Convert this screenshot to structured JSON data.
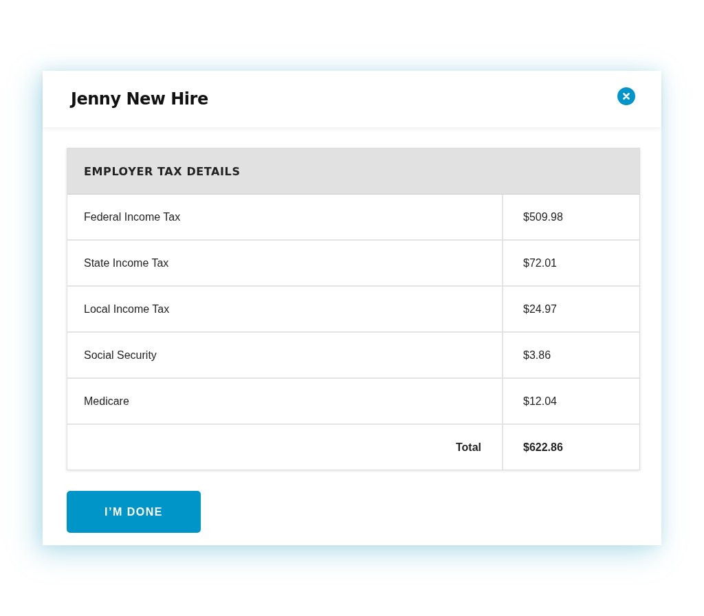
{
  "dialog": {
    "title": "Jenny New Hire"
  },
  "table": {
    "heading": "EMPLOYER TAX DETAILS",
    "rows": [
      {
        "label": "Federal Income Tax",
        "amount": "$509.98"
      },
      {
        "label": "State Income Tax",
        "amount": "$72.01"
      },
      {
        "label": "Local Income Tax",
        "amount": "$24.97"
      },
      {
        "label": "Social Security",
        "amount": "$3.86"
      },
      {
        "label": "Medicare",
        "amount": "$12.04"
      }
    ],
    "total": {
      "label": "Total",
      "amount": "$622.86"
    }
  },
  "buttons": [
    "I’M DONE"
  ]
}
